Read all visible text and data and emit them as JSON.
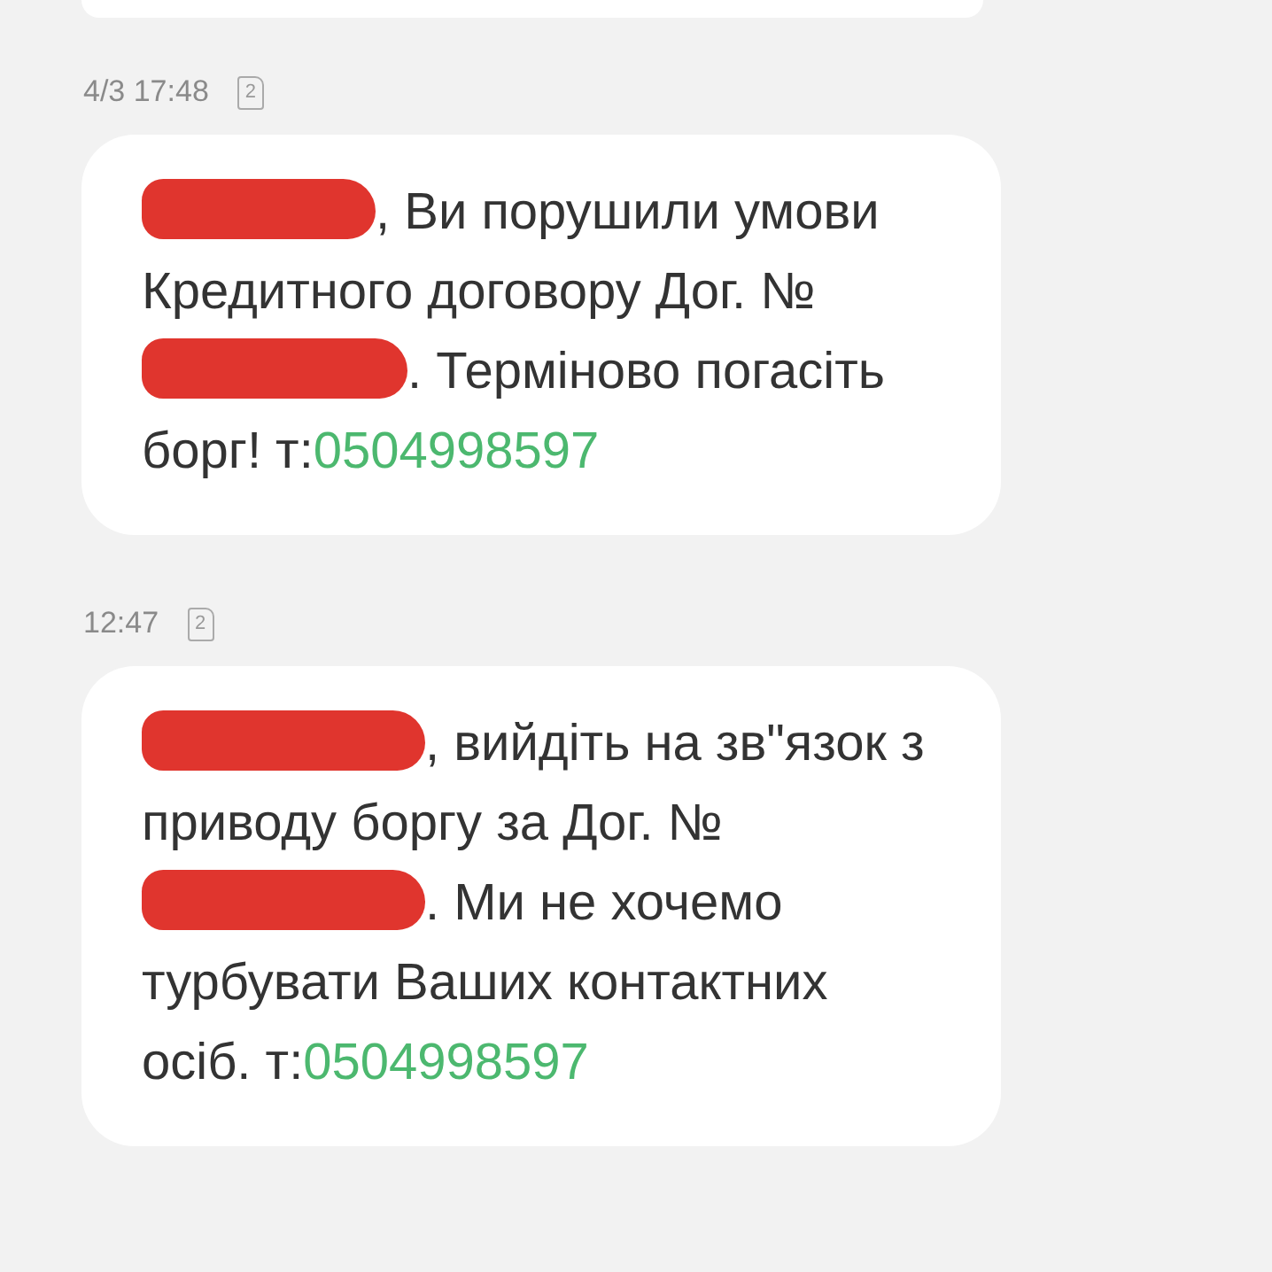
{
  "messages": [
    {
      "kind": "partial"
    },
    {
      "kind": "full",
      "time": "4/3 17:48",
      "sim": "2",
      "parts": [
        {
          "kind": "redaction"
        },
        {
          "kind": "text",
          "text": ", Ви порушили умови Кредитного договору Дог. №"
        },
        {
          "kind": "redaction"
        },
        {
          "kind": "text",
          "text": ". Терміново погасіть борг! т:"
        },
        {
          "kind": "link",
          "text": "0504998597"
        }
      ]
    },
    {
      "kind": "full",
      "time": "12:47",
      "sim": "2",
      "parts": [
        {
          "kind": "redaction"
        },
        {
          "kind": "text",
          "text": ", вийдіть на зв\"язок з приводу боргу за Дог. №"
        },
        {
          "kind": "redaction"
        },
        {
          "kind": "text",
          "text": ". Ми не хочемо турбувати Ваших контактних осіб. т:"
        },
        {
          "kind": "link",
          "text": "0504998597"
        }
      ]
    }
  ]
}
